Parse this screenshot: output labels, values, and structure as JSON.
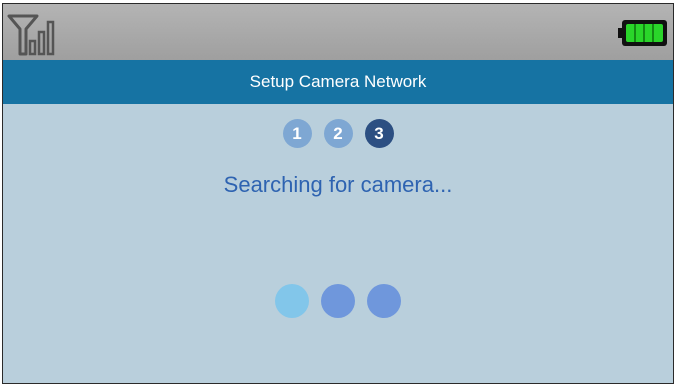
{
  "status_bar": {
    "signal_icon": "signal-icon",
    "battery_icon": "battery-icon",
    "battery_color": "#22cc22"
  },
  "header": {
    "title": "Setup Camera Network"
  },
  "steps": [
    {
      "label": "1",
      "state": "done"
    },
    {
      "label": "2",
      "state": "done"
    },
    {
      "label": "3",
      "state": "active"
    }
  ],
  "status_message": "Searching for camera...",
  "colors": {
    "title_bar": "#1673a3",
    "background": "#b9cfdc",
    "step_done": "#7ea7d3",
    "step_active": "#2c4f82",
    "message_text": "#2e63b1"
  }
}
